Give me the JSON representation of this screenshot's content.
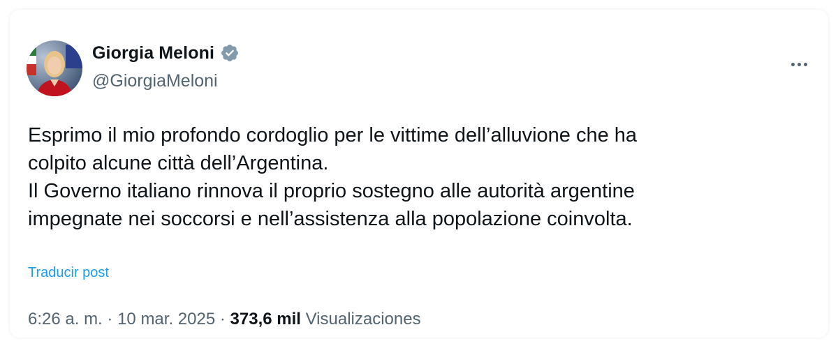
{
  "author": {
    "name": "Giorgia Meloni",
    "handle": "@GiorgiaMeloni",
    "verified_icon": "verified-badge-icon",
    "badge_color": "#829aab"
  },
  "more_menu": {
    "icon": "more-horizontal-icon"
  },
  "tweet": {
    "lines": [
      "Esprimo il mio profondo cordoglio per le vittime dell’alluvione che ha",
      "colpito alcune città dell’Argentina.",
      "Il Governo italiano rinnova il proprio sostegno alle autorità argentine",
      "impegnate nei soccorsi e nell’assistenza alla popolazione coinvolta."
    ],
    "translate_label": "Traducir post"
  },
  "meta": {
    "time": "6:26 a. m.",
    "separator": "·",
    "date": "10 mar. 2025",
    "views_count": "373,6 mil",
    "views_label": "Visualizaciones"
  },
  "colors": {
    "text_primary": "#0f1419",
    "text_secondary": "#536471",
    "link": "#1d9bf0"
  }
}
